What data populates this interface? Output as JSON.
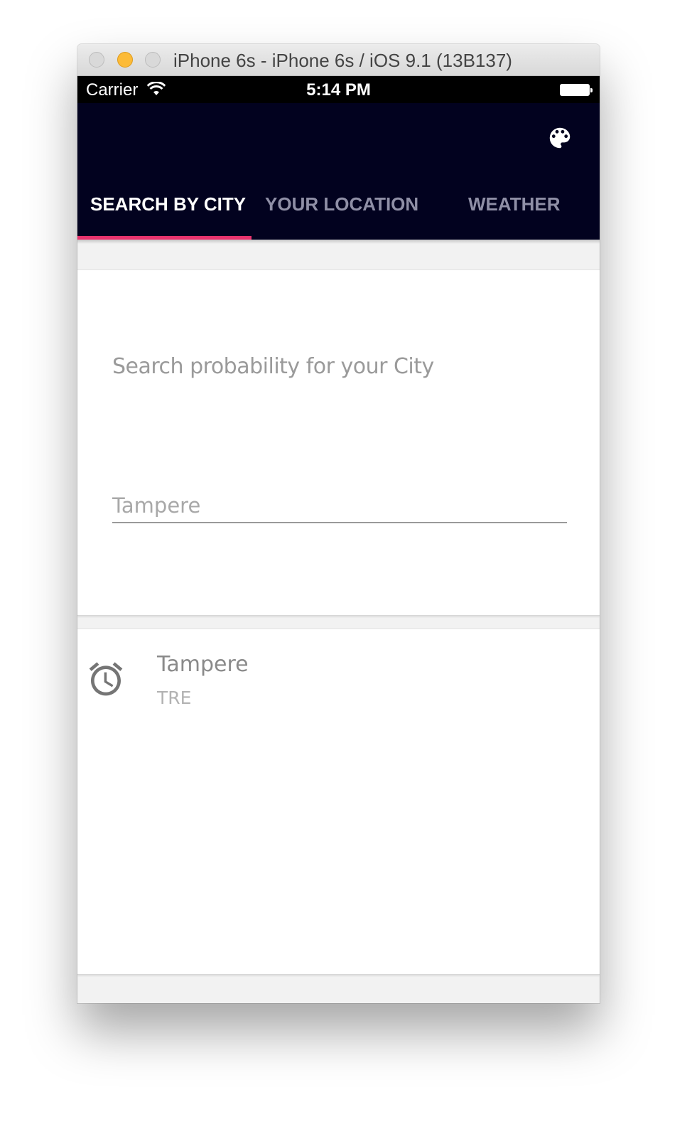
{
  "window": {
    "title": "iPhone 6s - iPhone 6s / iOS 9.1 (13B137)"
  },
  "status_bar": {
    "carrier": "Carrier",
    "time": "5:14 PM"
  },
  "app_bar": {
    "action_icon": "palette-icon",
    "tabs": [
      {
        "label": "SEARCH BY CITY",
        "active": true
      },
      {
        "label": "YOUR LOCATION",
        "active": false
      },
      {
        "label": "WEATHER",
        "active": false
      }
    ],
    "background_color": "#02021f",
    "indicator_color": "#e8336e"
  },
  "search_card": {
    "prompt": "Search probability for your City",
    "input_placeholder": "Tampere"
  },
  "history": {
    "items": [
      {
        "icon": "alarm-clock-icon",
        "title": "Tampere",
        "subtitle": "TRE"
      }
    ]
  }
}
